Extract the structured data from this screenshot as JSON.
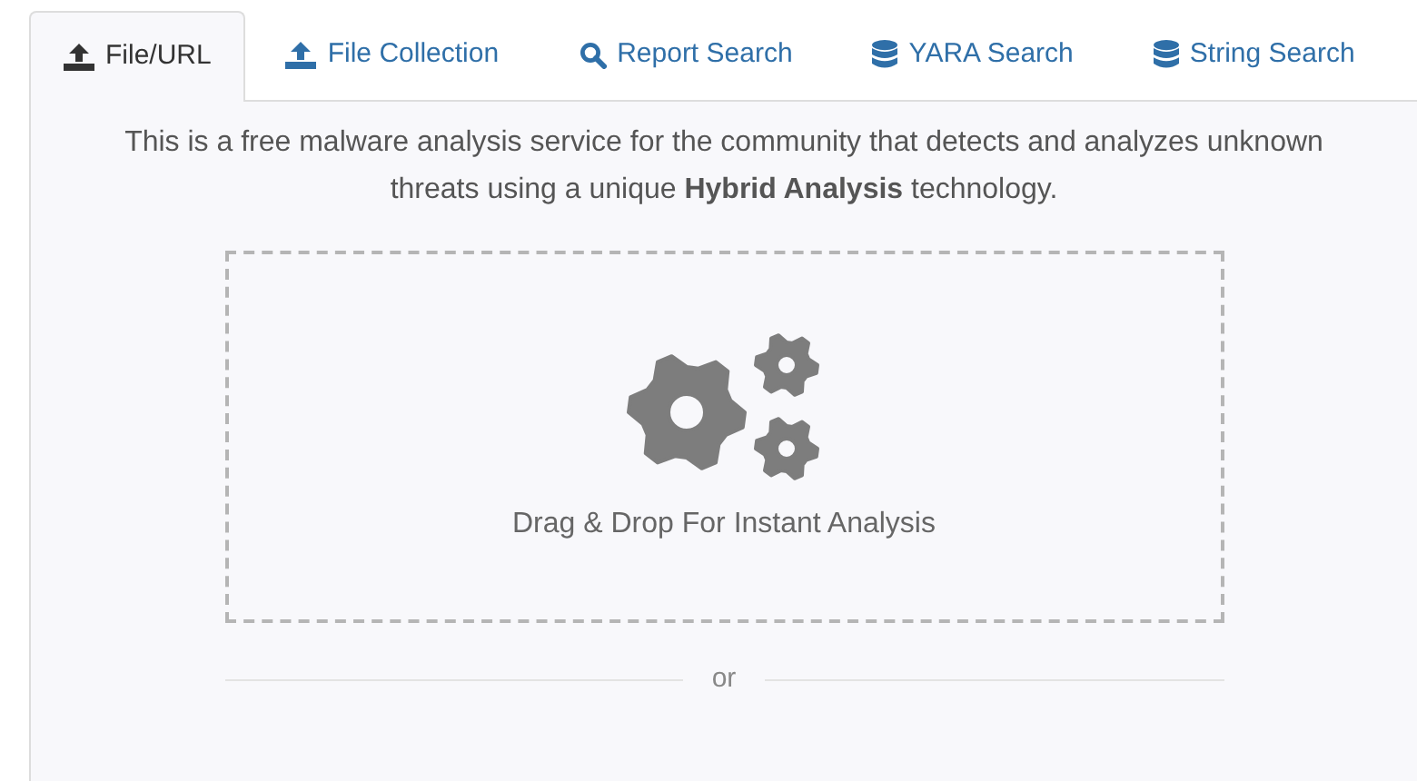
{
  "tabs": [
    {
      "label": "File/URL",
      "kind": "upload",
      "selected": true
    },
    {
      "label": "File Collection",
      "kind": "upload",
      "selected": false
    },
    {
      "label": "Report Search",
      "kind": "search",
      "selected": false
    },
    {
      "label": "YARA Search",
      "kind": "database",
      "selected": false
    },
    {
      "label": "String Search",
      "kind": "database",
      "selected": false
    }
  ],
  "intro": "This is a free malware analysis service for the community that detects and analyzes unknown threats using a unique **Hybrid Analysis** technology.",
  "drop_zone": {
    "label": "Drag & Drop For Instant Analysis"
  },
  "divider": "or"
}
